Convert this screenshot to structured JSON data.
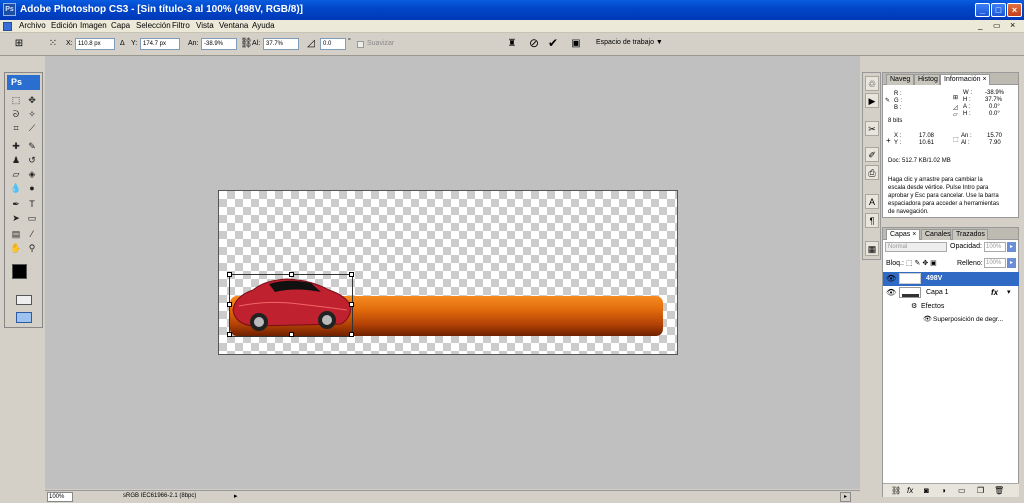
{
  "window": {
    "title": "Adobe Photoshop CS3 - [Sin título-3 al 100% (498V, RGB/8)]",
    "app_icon": "Ps",
    "minimize": "_",
    "maximize": "□",
    "close": "×"
  },
  "doc_window_buttons": {
    "minimize": "_",
    "restore": "▭",
    "close": "×"
  },
  "menu": [
    "Archivo",
    "Edición",
    "Imagen",
    "Capa",
    "Selección",
    "Filtro",
    "Vista",
    "Ventana",
    "Ayuda"
  ],
  "options": {
    "x_label": "X:",
    "x_value": "110.8 px",
    "delta_label": "Δ",
    "y_label": "Y:",
    "y_value": "174.7 px",
    "w_label": "An:",
    "w_value": "-38.9%",
    "h_label": "Al:",
    "h_value": "37.7%",
    "angle_value": "0.0",
    "degree": "°",
    "smooth_label": "Suavizar",
    "workspace_label": "Espacio de trabajo ▼"
  },
  "toolbox": {
    "logo": "Ps"
  },
  "info_panel": {
    "tabs": [
      "Naveg",
      "Histog",
      "Información"
    ],
    "tab_close": "×",
    "rgb": [
      {
        "k": "R :",
        "v": ""
      },
      {
        "k": "G :",
        "v": ""
      },
      {
        "k": "B :",
        "v": ""
      }
    ],
    "wh": [
      {
        "k": "W :",
        "v": "-38.9%"
      },
      {
        "k": "H :",
        "v": "37.7%"
      },
      {
        "k": "A :",
        "v": "0.0°"
      },
      {
        "k": "H :",
        "v": "0.0°"
      }
    ],
    "bits": "8 bits",
    "xy": [
      {
        "k": "X :",
        "v": "17.08"
      },
      {
        "k": "Y :",
        "v": "10.61"
      }
    ],
    "anal": [
      {
        "k": "An :",
        "v": "15.70"
      },
      {
        "k": "Al :",
        "v": "7.90"
      }
    ],
    "doc": "Doc: 512.7 KB/1.02 MB",
    "help": [
      "Haga clic y arrastre para cambiar la",
      "escala desde vértice. Pulse Intro para",
      "aprobar y Esc para cancelar. Use la barra",
      "espaciadora para acceder a herramientas",
      "de navegación."
    ]
  },
  "layers_panel": {
    "tabs": [
      "Capas",
      "Canales",
      "Trazados"
    ],
    "tab_close": "×",
    "blend_mode": "Normal",
    "opacity_label": "Opacidad:",
    "opacity_value": "100%",
    "lock_label": "Bloq.:",
    "fill_label": "Relleno:",
    "fill_value": "100%",
    "layers": [
      {
        "name": "498V",
        "selected": true
      },
      {
        "name": "Capa 1",
        "selected": false,
        "fx": "fx"
      }
    ],
    "effects_label": "Efectos",
    "effect_item": "Superposición de degr..."
  },
  "status": {
    "zoom": "100%",
    "profile": "sRGB IEC61966-2.1 (8bpc)"
  },
  "colors": {
    "accent": "#0147c9",
    "bar_top": "#f68b20",
    "bar_bottom": "#6e2000",
    "car": "#c0212e",
    "selected_layer": "#316ac5"
  }
}
